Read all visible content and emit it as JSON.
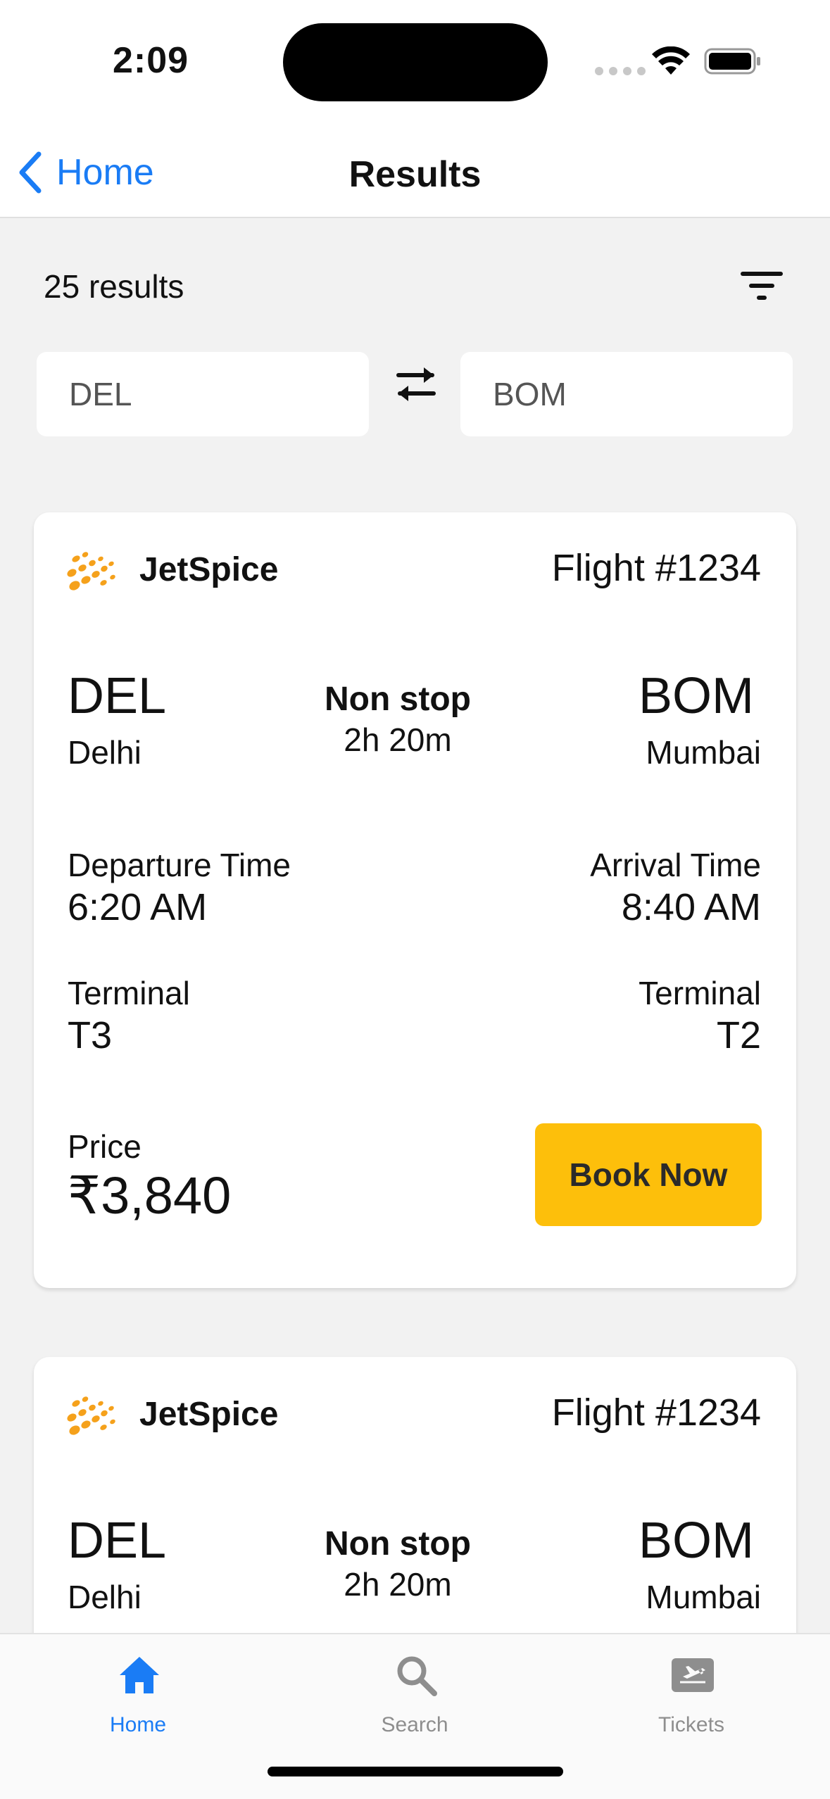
{
  "status_bar": {
    "time": "2:09"
  },
  "nav": {
    "back_label": "Home",
    "title": "Results"
  },
  "results": {
    "count_label": "25 results"
  },
  "route": {
    "from": "DEL",
    "to": "BOM"
  },
  "colors": {
    "accent": "#1a7cf5",
    "book_button": "#fdbf0b",
    "logo": "#f5a11b"
  },
  "flights": [
    {
      "airline": "JetSpice",
      "flight_number": "Flight #1234",
      "from_code": "DEL",
      "from_city": "Delhi",
      "to_code": "BOM",
      "to_city": "Mumbai",
      "stops": "Non stop",
      "duration": "2h 20m",
      "departure_label": "Departure Time",
      "departure_time": "6:20 AM",
      "arrival_label": "Arrival Time",
      "arrival_time": "8:40 AM",
      "terminal_label": "Terminal",
      "departure_terminal": "T3",
      "arrival_terminal": "T2",
      "price_label": "Price",
      "price": "₹3,840",
      "book_label": "Book Now"
    },
    {
      "airline": "JetSpice",
      "flight_number": "Flight #1234",
      "from_code": "DEL",
      "from_city": "Delhi",
      "to_code": "BOM",
      "to_city": "Mumbai",
      "stops": "Non stop",
      "duration": "2h 20m"
    }
  ],
  "tab_bar": {
    "items": [
      {
        "label": "Home",
        "icon": "home-icon",
        "active": true
      },
      {
        "label": "Search",
        "icon": "search-icon",
        "active": false
      },
      {
        "label": "Tickets",
        "icon": "ticket-icon",
        "active": false
      }
    ]
  }
}
